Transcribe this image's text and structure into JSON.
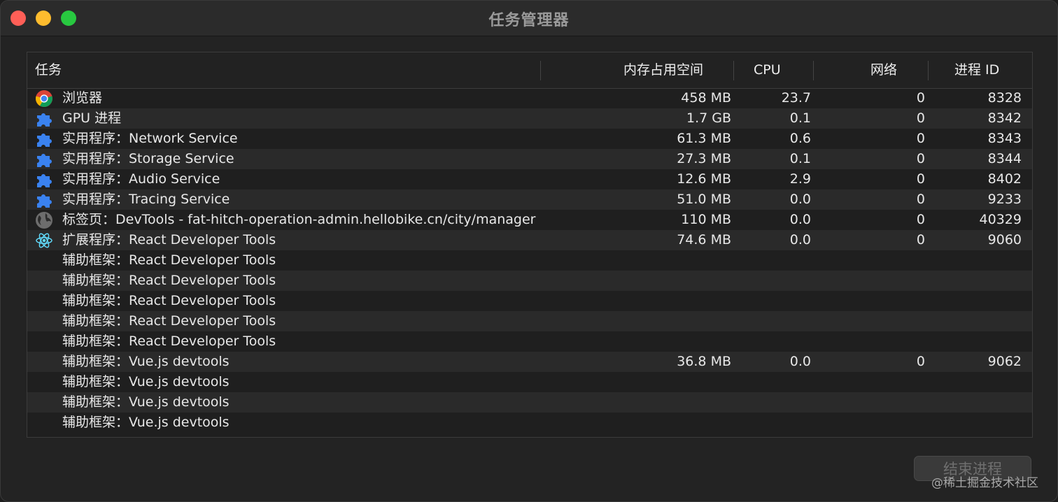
{
  "window": {
    "title": "任务管理器"
  },
  "table": {
    "headers": {
      "task": "任务",
      "memory": "内存占用空间",
      "cpu": "CPU",
      "network": "网络",
      "pid": "进程 ID"
    },
    "rows": [
      {
        "icon": "chrome-icon",
        "task": "浏览器",
        "memory": "458 MB",
        "cpu": "23.7",
        "network": "0",
        "pid": "8328"
      },
      {
        "icon": "puzzle-icon",
        "task": "GPU 进程",
        "memory": "1.7 GB",
        "cpu": "0.1",
        "network": "0",
        "pid": "8342"
      },
      {
        "icon": "puzzle-icon",
        "task": "实用程序：Network Service",
        "memory": "61.3 MB",
        "cpu": "0.6",
        "network": "0",
        "pid": "8343"
      },
      {
        "icon": "puzzle-icon",
        "task": "实用程序：Storage Service",
        "memory": "27.3 MB",
        "cpu": "0.1",
        "network": "0",
        "pid": "8344"
      },
      {
        "icon": "puzzle-icon",
        "task": "实用程序：Audio Service",
        "memory": "12.6 MB",
        "cpu": "2.9",
        "network": "0",
        "pid": "8402"
      },
      {
        "icon": "puzzle-icon",
        "task": "实用程序：Tracing Service",
        "memory": "51.0 MB",
        "cpu": "0.0",
        "network": "0",
        "pid": "9233"
      },
      {
        "icon": "globe-icon",
        "task": "标签页：DevTools - fat-hitch-operation-admin.hellobike.cn/city/manager",
        "memory": "110 MB",
        "cpu": "0.0",
        "network": "0",
        "pid": "40329"
      },
      {
        "icon": "react-icon",
        "task": "扩展程序：React Developer Tools",
        "memory": "74.6 MB",
        "cpu": "0.0",
        "network": "0",
        "pid": "9060"
      },
      {
        "icon": "",
        "task": "辅助框架：React Developer Tools",
        "memory": "",
        "cpu": "",
        "network": "",
        "pid": ""
      },
      {
        "icon": "",
        "task": "辅助框架：React Developer Tools",
        "memory": "",
        "cpu": "",
        "network": "",
        "pid": ""
      },
      {
        "icon": "",
        "task": "辅助框架：React Developer Tools",
        "memory": "",
        "cpu": "",
        "network": "",
        "pid": ""
      },
      {
        "icon": "",
        "task": "辅助框架：React Developer Tools",
        "memory": "",
        "cpu": "",
        "network": "",
        "pid": ""
      },
      {
        "icon": "",
        "task": "辅助框架：React Developer Tools",
        "memory": "",
        "cpu": "",
        "network": "",
        "pid": ""
      },
      {
        "icon": "",
        "task": "辅助框架：Vue.js devtools",
        "memory": "36.8 MB",
        "cpu": "0.0",
        "network": "0",
        "pid": "9062"
      },
      {
        "icon": "",
        "task": "辅助框架：Vue.js devtools",
        "memory": "",
        "cpu": "",
        "network": "",
        "pid": ""
      },
      {
        "icon": "",
        "task": "辅助框架：Vue.js devtools",
        "memory": "",
        "cpu": "",
        "network": "",
        "pid": ""
      },
      {
        "icon": "",
        "task": "辅助框架：Vue.js devtools",
        "memory": "",
        "cpu": "",
        "network": "",
        "pid": ""
      }
    ]
  },
  "footer": {
    "end_process_label": "结束进程"
  },
  "watermark": "@稀土掘金技术社区"
}
